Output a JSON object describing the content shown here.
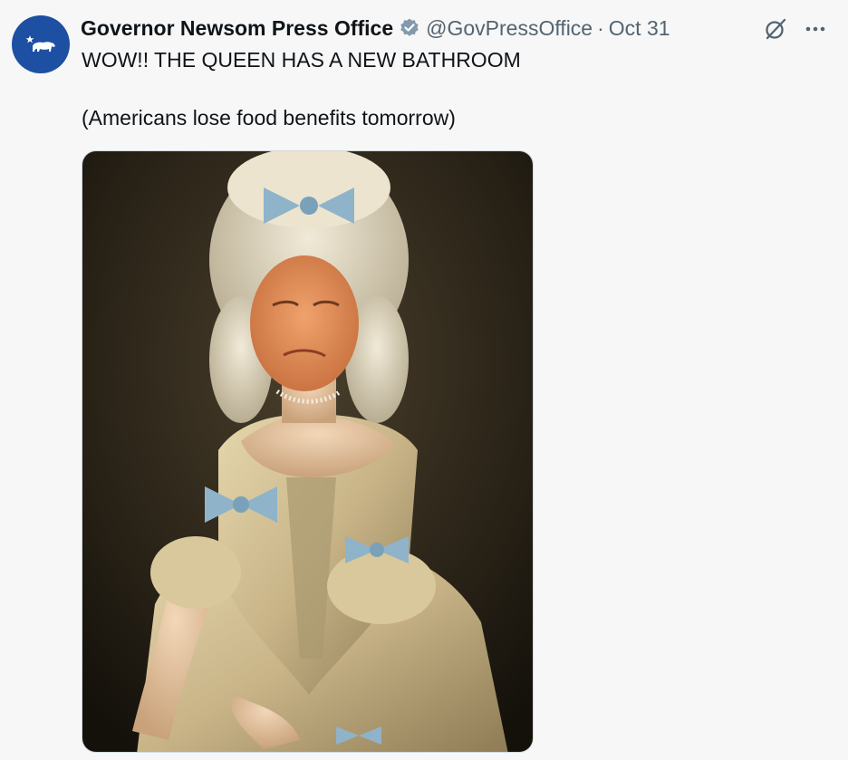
{
  "tweet": {
    "author": {
      "display_name": "Governor Newsom Press Office",
      "handle": "@GovPressOffice",
      "verified": true,
      "avatar_icon": "california-bear-icon",
      "avatar_color": "#1d4fa3"
    },
    "separator": "·",
    "date": "Oct 31",
    "text_lines": [
      "WOW!! THE QUEEN HAS A NEW BATHROOM",
      "(Americans lose food benefits tomorrow)"
    ],
    "media": {
      "type": "image",
      "icon": "portrait-painting-image"
    },
    "actions": {
      "grok_icon": "grok-icon",
      "more_icon": "more-dots-icon"
    }
  },
  "colors": {
    "background": "#f7f7f7",
    "text_primary": "#0f1419",
    "text_secondary": "#536471",
    "verified_badge": "#829aab"
  }
}
